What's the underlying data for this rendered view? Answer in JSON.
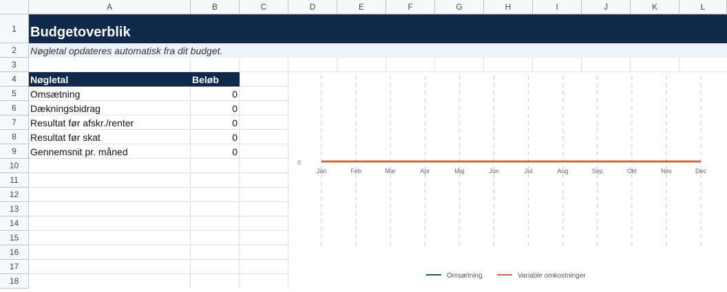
{
  "columns": [
    "A",
    "B",
    "C",
    "D",
    "E",
    "F",
    "G",
    "H",
    "I",
    "J",
    "K",
    "L"
  ],
  "rows": [
    "1",
    "2",
    "3",
    "4",
    "5",
    "6",
    "7",
    "8",
    "9",
    "10",
    "11",
    "12",
    "13",
    "14",
    "15",
    "16",
    "17",
    "18"
  ],
  "title": "Budgetoverblik",
  "subtitle": "Nøgletal opdateres automatisk fra dit budget.",
  "table": {
    "header": [
      "Nøgletal",
      "Beløb"
    ],
    "rows": [
      {
        "label": "Omsætning",
        "value": "0"
      },
      {
        "label": "Dækningsbidrag",
        "value": "0"
      },
      {
        "label": "Resultat før afskr./renter",
        "value": "0"
      },
      {
        "label": "Resultat før skat",
        "value": "0"
      },
      {
        "label": "Gennemsnit pr. måned",
        "value": "0"
      }
    ]
  },
  "colors": {
    "header_bg": "#10294a",
    "series1": "#1f4e79",
    "series2": "#c8693a"
  },
  "chart_data": {
    "type": "line",
    "categories": [
      "Jan",
      "Feb",
      "Mar",
      "Apr",
      "Maj",
      "Jun",
      "Jul",
      "Aug",
      "Sep",
      "Okt",
      "Nov",
      "Dec"
    ],
    "y_ticks": [
      "0"
    ],
    "series": [
      {
        "name": "Omsætning",
        "values": [
          0,
          0,
          0,
          0,
          0,
          0,
          0,
          0,
          0,
          0,
          0,
          0
        ],
        "color": "#1f4e79"
      },
      {
        "name": "Variable omkostninger",
        "values": [
          0,
          0,
          0,
          0,
          0,
          0,
          0,
          0,
          0,
          0,
          0,
          0
        ],
        "color": "#c8693a"
      }
    ],
    "grid": "vertical-dashed",
    "legend": "bottom"
  }
}
